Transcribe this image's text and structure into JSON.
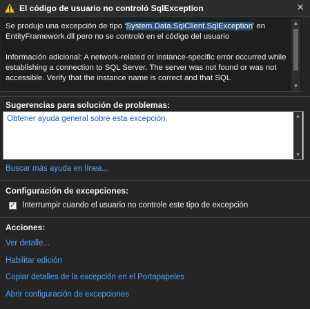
{
  "dialog": {
    "title": "El código de usuario no controló SqlException",
    "close_glyph": "✕"
  },
  "message": {
    "pre": "Se produjo una excepción de tipo '",
    "highlight": "System.Data.SqlClient.SqlException",
    "post": "' en EntityFramework.dll pero no se controló en el código del usuario\n\nInformación adicional: A network-related or instance-specific error occurred while establishing a connection to SQL Server. The server was not found or was not accessible. Verify that the instance name is correct and that SQL"
  },
  "troubleshooting": {
    "heading": "Sugerencias para solución de problemas:",
    "suggestion": "Obtener ayuda general sobre esta excepción.",
    "more_help": "Buscar más ayuda en línea..."
  },
  "exception_settings": {
    "heading": "Configuración de excepciones:",
    "checkbox_label": "Interrumpir cuando el usuario no controle este tipo de excepción",
    "checked": true,
    "check_glyph": "✓"
  },
  "actions": {
    "heading": "Acciones:",
    "items": [
      "Ver detalle...",
      "Habilitar edición",
      "Copiar detalles de la excepción en el Portapapeles",
      "Abrir configuración de excepciones"
    ]
  },
  "colors": {
    "background": "#252526",
    "link": "#4fa3ff",
    "highlight": "#264f78",
    "warning": "#f0c419"
  }
}
